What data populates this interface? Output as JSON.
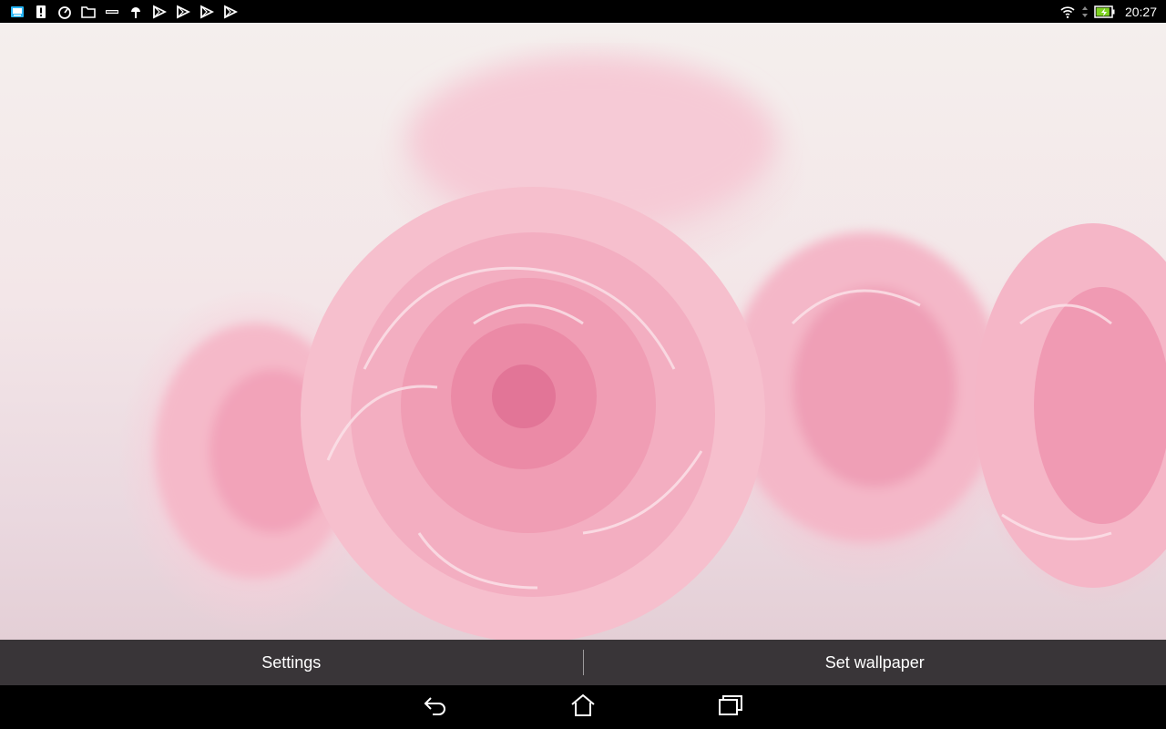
{
  "status_bar": {
    "left_icons": [
      "screen-mirror-icon",
      "alert-icon",
      "speed-icon",
      "folder-icon",
      "asus-icon",
      "android-debug-icon",
      "play-store-icon",
      "play-store-icon",
      "play-store-icon",
      "play-store-icon"
    ],
    "right_icons": [
      "wifi-icon",
      "data-arrows-icon",
      "battery-charging-icon"
    ],
    "time": "20:27",
    "battery_level": 0.9
  },
  "wallpaper": {
    "description_colors": {
      "petal": "#f4a9bf",
      "background": "#f3ebec"
    }
  },
  "action_bar": {
    "settings_label": "Settings",
    "set_wallpaper_label": "Set wallpaper"
  },
  "nav_bar": {
    "icons": [
      "back-icon",
      "home-icon",
      "recents-icon"
    ]
  },
  "colors": {
    "status_bar_bg": "#000000",
    "action_bar_bg": "#464144",
    "nav_bar_bg": "#000000",
    "text": "#ffffff",
    "battery_fill": "#7ed321"
  }
}
